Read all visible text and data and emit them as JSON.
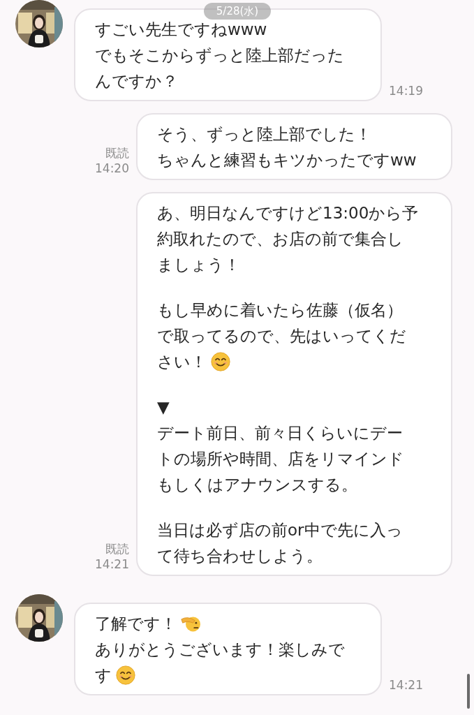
{
  "date_badge": "5/28(水)",
  "messages": [
    {
      "kind": "incoming",
      "time": "14:19",
      "paragraphs": [
        [
          [
            {
              "kind": "text",
              "text": "すごい先生ですねwww"
            }
          ],
          [
            {
              "kind": "text",
              "text": "でもそこからずっと陸上部だった"
            }
          ],
          [
            {
              "kind": "text",
              "text": "んですか？"
            }
          ]
        ]
      ]
    },
    {
      "kind": "outgoing",
      "time": "14:20",
      "read_label": "既読",
      "paragraphs": [
        [
          [
            {
              "kind": "text",
              "text": "そう、ずっと陸上部でした！"
            }
          ],
          [
            {
              "kind": "text",
              "text": "ちゃんと練習もキツかったですww"
            }
          ]
        ]
      ]
    },
    {
      "kind": "outgoing",
      "time": "14:21",
      "read_label": "既読",
      "paragraphs": [
        [
          [
            {
              "kind": "text",
              "text": "あ、明日なんですけど13:00から予"
            }
          ],
          [
            {
              "kind": "text",
              "text": "約取れたので、お店の前で集合し"
            }
          ],
          [
            {
              "kind": "text",
              "text": "ましょう！"
            }
          ]
        ],
        [
          [
            {
              "kind": "text",
              "text": "もし早めに着いたら佐藤（仮名）"
            }
          ],
          [
            {
              "kind": "text",
              "text": "で取ってるので、先はいってくだ"
            }
          ],
          [
            {
              "kind": "text",
              "text": "さい！"
            },
            {
              "kind": "smile"
            }
          ]
        ],
        [
          [
            {
              "kind": "text",
              "text": "▼"
            }
          ],
          [
            {
              "kind": "text",
              "text": "デート前日、前々日くらいにデー"
            }
          ],
          [
            {
              "kind": "text",
              "text": "トの場所や時間、店をリマインド"
            }
          ],
          [
            {
              "kind": "text",
              "text": "もしくはアナウンスする。"
            }
          ]
        ],
        [
          [
            {
              "kind": "text",
              "text": "当日は必ず店の前or中で先に入っ"
            }
          ],
          [
            {
              "kind": "text",
              "text": "て待ち合わせしよう。"
            }
          ]
        ]
      ]
    },
    {
      "kind": "incoming",
      "time": "14:21",
      "paragraphs": [
        [
          [
            {
              "kind": "text",
              "text": "了解です！"
            },
            {
              "kind": "salute"
            }
          ],
          [
            {
              "kind": "text",
              "text": "ありがとうございます！楽しみで"
            }
          ],
          [
            {
              "kind": "text",
              "text": "す"
            },
            {
              "kind": "smile"
            }
          ]
        ]
      ]
    }
  ]
}
